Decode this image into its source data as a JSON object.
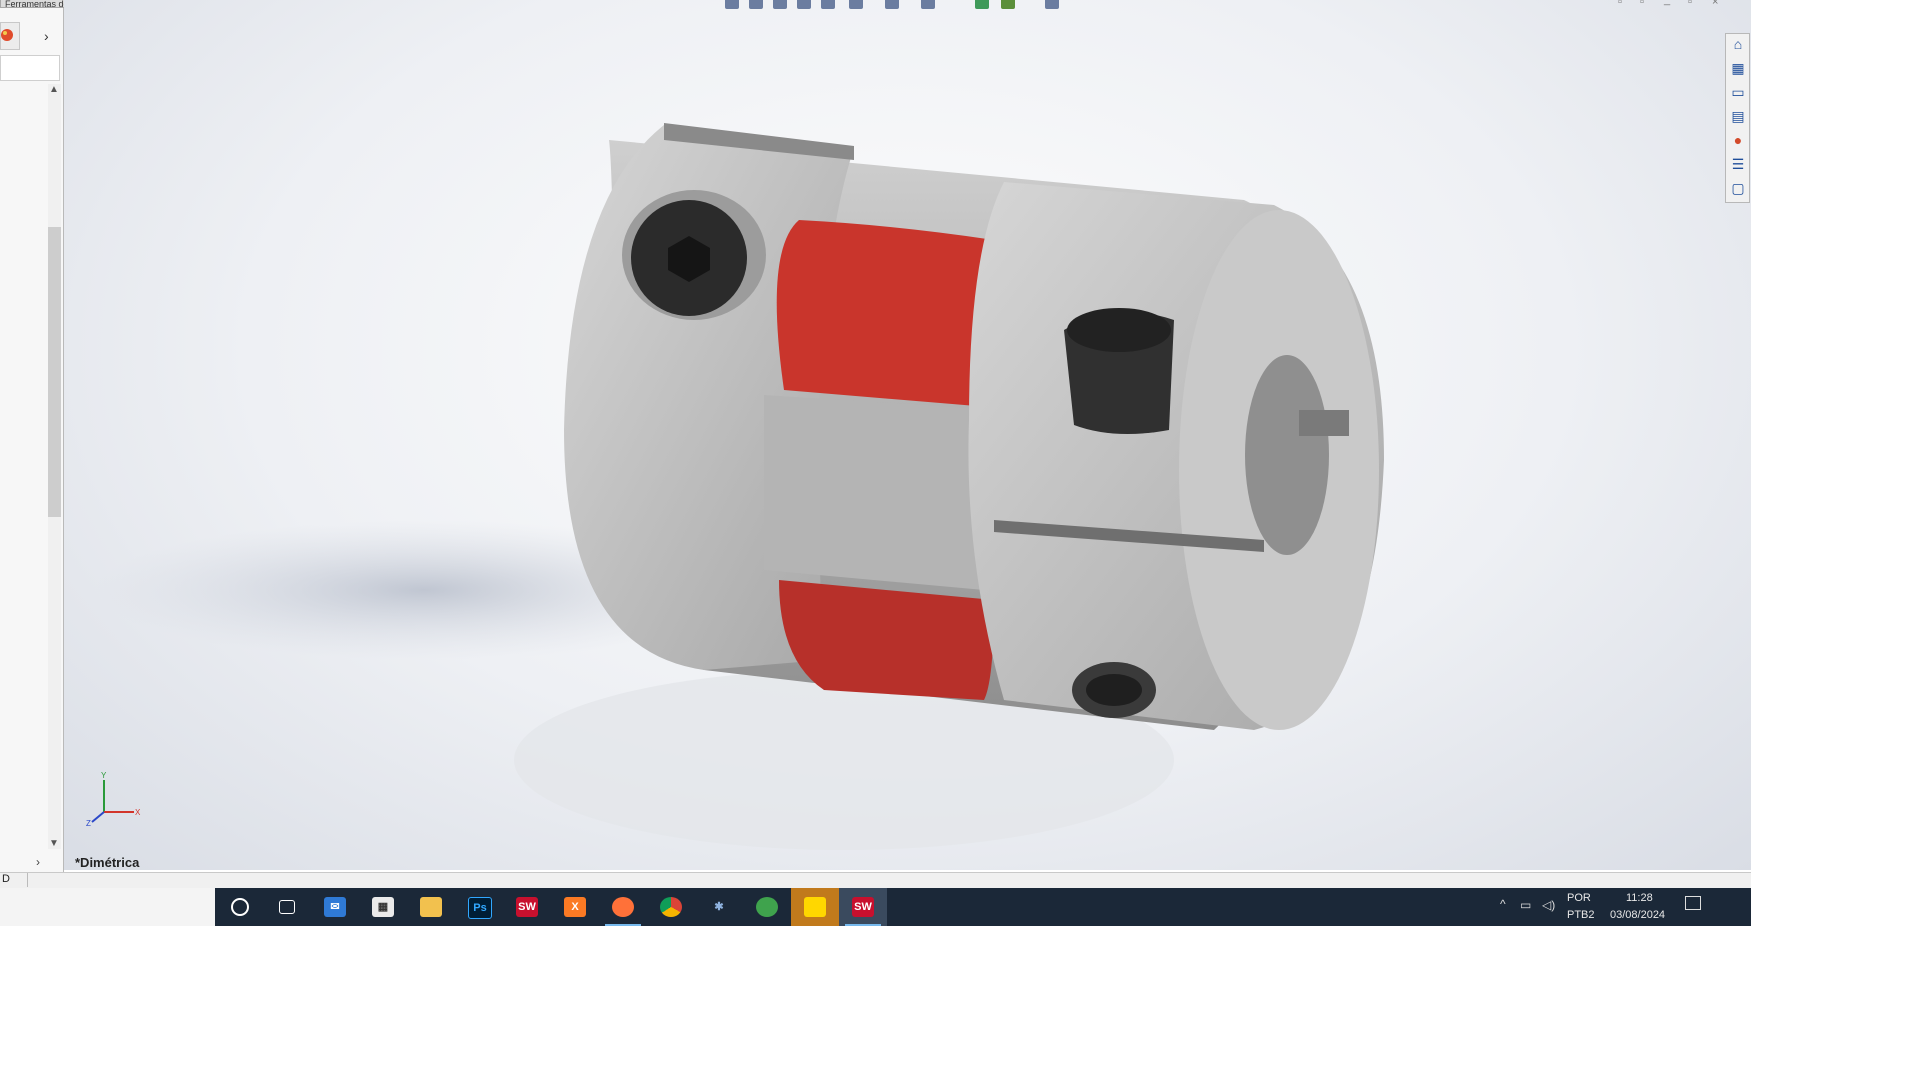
{
  "top_tab": {
    "label": "Ferramentas de renderização"
  },
  "left_panel": {
    "chevron": "›",
    "bottom_chevron": "›"
  },
  "viewport": {
    "view_name": "*Dimétrica"
  },
  "triad": {
    "x_label": "X",
    "y_label": "Y",
    "z_label": "Z"
  },
  "status_bar": {
    "text": "D"
  },
  "taskbar": {
    "apps": [
      {
        "name": "cortana-search-icon",
        "label": ""
      },
      {
        "name": "task-view-icon",
        "label": ""
      },
      {
        "name": "mail-app-icon",
        "label": ""
      },
      {
        "name": "microsoft-store-icon",
        "label": ""
      },
      {
        "name": "file-explorer-icon",
        "label": ""
      },
      {
        "name": "photoshop-icon",
        "label": "Ps"
      },
      {
        "name": "solidworks-2016-icon",
        "label": "SW"
      },
      {
        "name": "xampp-icon",
        "label": "X"
      },
      {
        "name": "firefox-icon",
        "label": ""
      },
      {
        "name": "chrome-icon",
        "label": ""
      },
      {
        "name": "network-app-icon",
        "label": ""
      },
      {
        "name": "globe-app-icon",
        "label": ""
      },
      {
        "name": "sticky-notes-icon",
        "label": ""
      },
      {
        "name": "solidworks-2016-active-icon",
        "label": "SW"
      }
    ],
    "tray": {
      "lang_top": "POR",
      "lang_bottom": "PTB2",
      "time": "11:28",
      "date": "03/08/2024"
    }
  },
  "colors": {
    "taskbar": "#1b2838",
    "coupling_metal": "#b7b7b7",
    "spider_red": "#c9352c",
    "screw_black": "#2b2b2b",
    "task_pane_icon": "#1f4e9a"
  }
}
